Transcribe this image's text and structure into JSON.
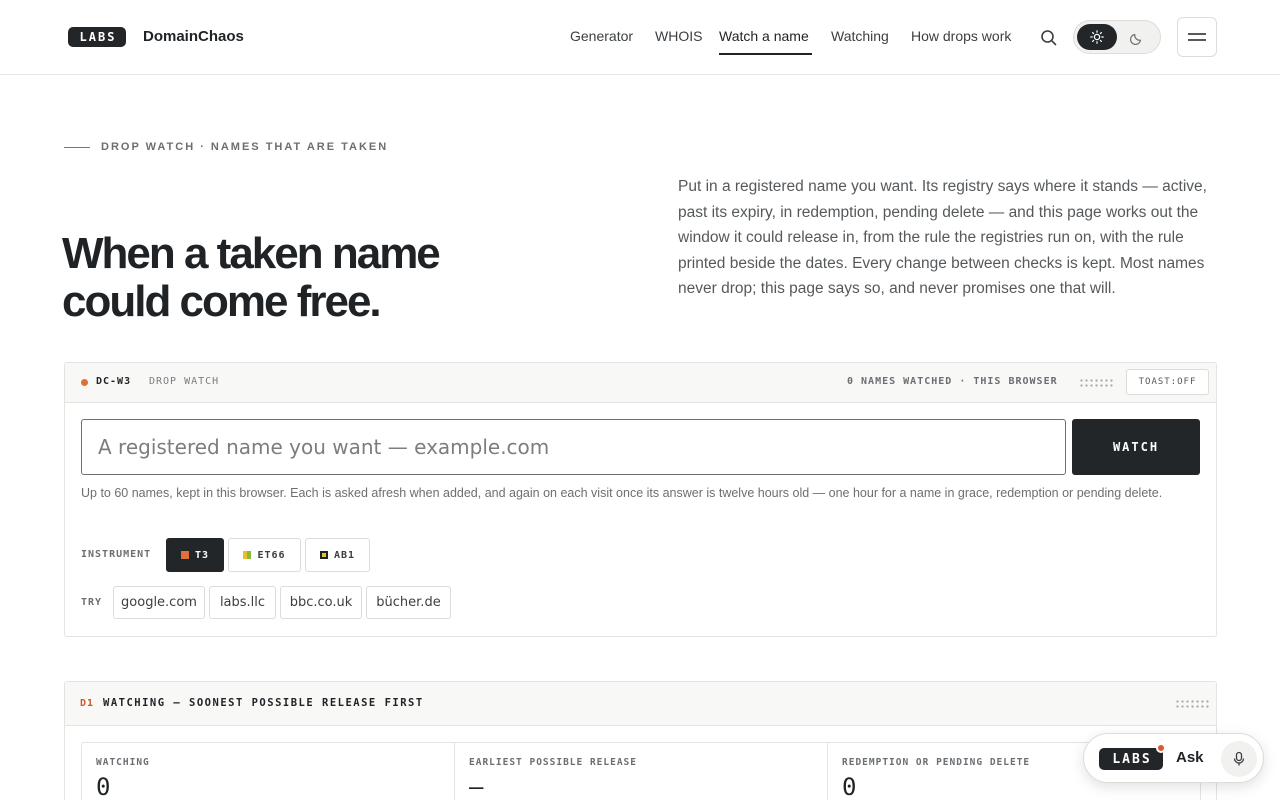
{
  "header": {
    "logo_text": "LABS",
    "brand": "DomainChaos",
    "nav": [
      {
        "label": "Generator"
      },
      {
        "label": "WHOIS"
      },
      {
        "label": "Watch a name",
        "active": true
      },
      {
        "label": "Watching"
      },
      {
        "label": "How drops work"
      }
    ],
    "theme": {
      "selected": "light"
    },
    "icons": {
      "search": "search-icon",
      "sun": "sun-icon",
      "moon": "moon-icon",
      "menu": "menu-icon"
    }
  },
  "hero": {
    "eyebrow": "DROP WATCH · NAMES THAT ARE TAKEN",
    "title_line1": "When a taken name",
    "title_line2": "could come free.",
    "description": "Put in a registered name you want. Its registry says where it stands — active, past its expiry, in redemption, pending delete — and this page works out the window it could release in, from the rule the registries run on, with the rule printed beside the dates. Every change between checks is kept. Most names never drop; this page says so, and never promises one that will."
  },
  "watch_panel": {
    "code": "DC-W3",
    "code_label": "DROP WATCH",
    "watched_count": "0 NAMES WATCHED · THIS BROWSER",
    "toast_label": "TOAST:OFF",
    "input_placeholder": "A registered name you want — example.com",
    "input_value": "",
    "watch_button": "WATCH",
    "help_text": "Up to 60 names, kept in this browser. Each is asked afresh when added, and again on each visit once its answer is twelve hours old — one hour for a name in grace, redemption or pending delete.",
    "instrument_label": "INSTRUMENT",
    "instruments": [
      {
        "label": "T3",
        "selected": true,
        "color": "#e0703a"
      },
      {
        "label": "ET66",
        "selected": false,
        "color": "#8db63c"
      },
      {
        "label": "AB1",
        "selected": false,
        "color": "#e8c12a"
      }
    ],
    "try_label": "TRY",
    "try_examples": [
      "google.com",
      "labs.llc",
      "bbc.co.uk",
      "bücher.de"
    ]
  },
  "watching_panel": {
    "code": "D1",
    "title": "WATCHING — SOONEST POSSIBLE RELEASE FIRST",
    "stats": [
      {
        "label": "WATCHING",
        "value": "0"
      },
      {
        "label": "EARLIEST POSSIBLE RELEASE",
        "value": "—"
      },
      {
        "label": "REDEMPTION OR PENDING DELETE",
        "value": "0"
      }
    ]
  },
  "ask_widget": {
    "logo_text": "LABS",
    "label": "Ask",
    "icon": "microphone-icon"
  },
  "colors": {
    "accent": "#c8582e",
    "dark": "#222629",
    "status_dot": "#e0703a"
  }
}
